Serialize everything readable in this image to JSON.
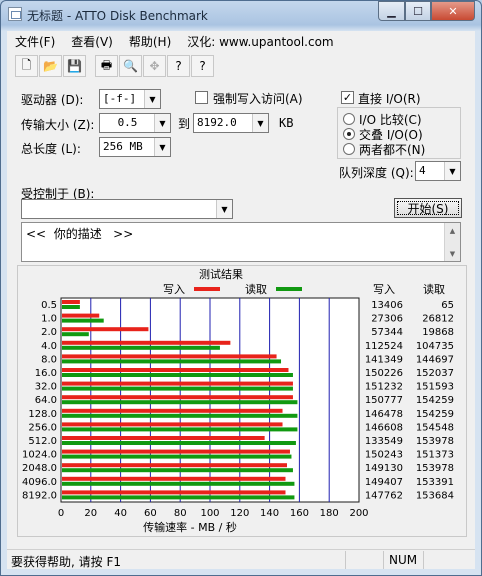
{
  "window": {
    "title": "无标题 - ATTO Disk Benchmark"
  },
  "menu": [
    "文件(F)",
    "查看(V)",
    "帮助(H)",
    "汉化: www.upantool.com"
  ],
  "toolbar": {
    "icons": [
      "new-file-icon",
      "open-folder-icon",
      "save-icon",
      "print-icon",
      "print-preview-icon",
      "move-icon",
      "help-icon",
      "context-help-icon"
    ],
    "glyphs": [
      "🗋",
      "📂",
      "💾",
      "🖶",
      "🔍",
      "✥",
      "?",
      "?"
    ]
  },
  "form": {
    "drive_label": "驱动器 (D):",
    "drive_value": "[-f-]",
    "force_write_label": "强制写入访问(A)",
    "force_write_checked": false,
    "transfer_label": "传输大小 (Z):",
    "transfer_from": "0.5",
    "to_label": "到",
    "transfer_to": "8192.0",
    "kb_label": "KB",
    "total_label": "总长度 (L):",
    "total_value": "256 MB",
    "direct_io_label": "直接 I/O(R)",
    "direct_io_checked": true,
    "io_compare_label": "I/O 比较(C)",
    "io_overlap_label": "交叠 I/O(O)",
    "neither_label": "两者都不(N)",
    "selected_io": "overlap",
    "queue_label": "队列深度 (Q):",
    "queue_value": "4",
    "controlled_label": "受控制于 (B):",
    "controlled_value": "",
    "start_button": "开始(S)",
    "description": "<<  你的描述   >>"
  },
  "results": {
    "title": "测试结果",
    "write_legend": "写入",
    "read_legend": "读取",
    "write_col": "写入",
    "read_col": "读取",
    "x_label": "传输速率 - MB / 秒"
  },
  "chart_data": {
    "type": "bar",
    "title": "测试结果",
    "xlabel": "传输速率 - MB / 秒",
    "ylabel": "",
    "orientation": "horizontal",
    "xlim": [
      0,
      200
    ],
    "xticks": [
      "0",
      "20",
      "40",
      "60",
      "80",
      "100",
      "120",
      "140",
      "160",
      "180",
      "200"
    ],
    "categories": [
      "0.5",
      "1.0",
      "2.0",
      "4.0",
      "8.0",
      "16.0",
      "32.0",
      "64.0",
      "128.0",
      "256.0",
      "512.0",
      "1024.0",
      "2048.0",
      "4096.0",
      "8192.0"
    ],
    "series": [
      {
        "name": "写入",
        "color": "#e8231b",
        "values": [
          12,
          25,
          58,
          113,
          144,
          152,
          155,
          155,
          148,
          148,
          136,
          153,
          151,
          150,
          150
        ]
      },
      {
        "name": "读取",
        "color": "#119911",
        "values": [
          12,
          28,
          18,
          106,
          147,
          155,
          155,
          158,
          158,
          158,
          157,
          154,
          155,
          156,
          156
        ]
      }
    ],
    "write_kb_values": [
      "13406",
      "27306",
      "57344",
      "112524",
      "141349",
      "150226",
      "151232",
      "150777",
      "146478",
      "146608",
      "133549",
      "150243",
      "149130",
      "149407",
      "147762"
    ],
    "read_kb_values": [
      "65",
      "26812",
      "19868",
      "104735",
      "144697",
      "152037",
      "151593",
      "154259",
      "154259",
      "154548",
      "153978",
      "151373",
      "153978",
      "153391",
      "153684"
    ]
  },
  "status": {
    "help_text": "要获得帮助, 请按 F1",
    "num": "NUM"
  },
  "colors": {
    "write": "#e8231b",
    "read": "#119911",
    "grid": "#1f1fb0"
  }
}
